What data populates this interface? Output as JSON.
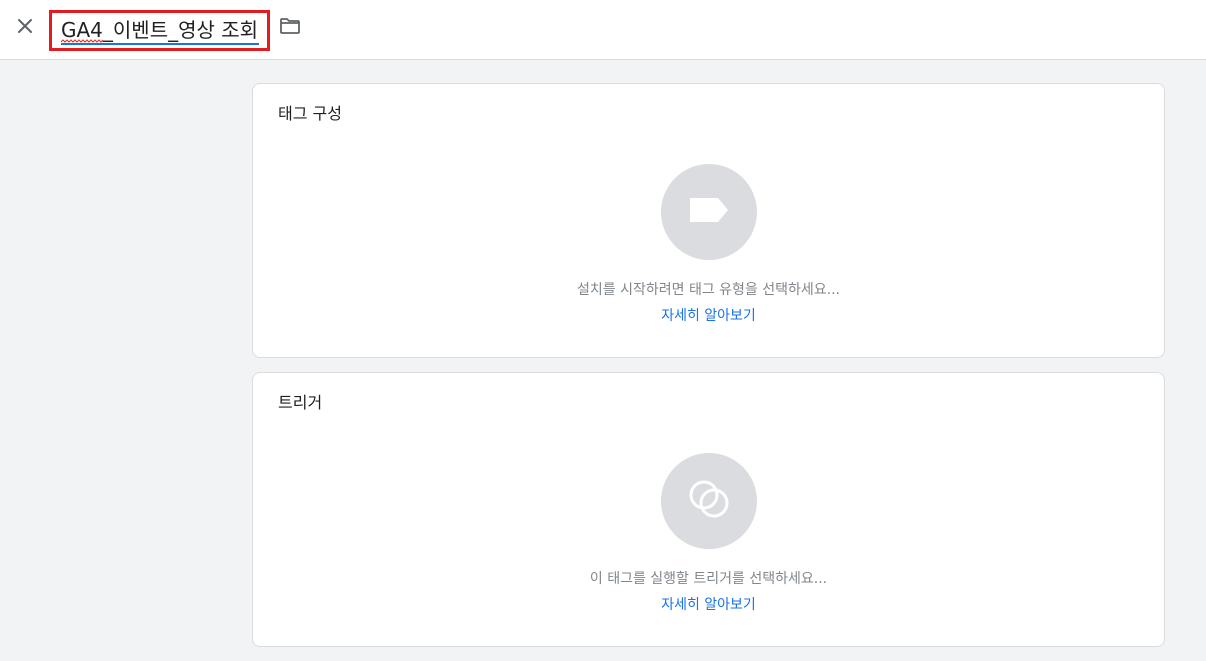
{
  "header": {
    "title": "GA4_이벤트_영상 조회",
    "close_icon": "close-icon",
    "folder_icon": "folder-icon"
  },
  "tag_config": {
    "title": "태그 구성",
    "icon": "tag-icon",
    "hint": "설치를 시작하려면 태그 유형을 선택하세요...",
    "learn_more": "자세히 알아보기"
  },
  "triggers": {
    "title": "트리거",
    "icon": "trigger-icon",
    "hint": "이 태그를 실행할 트리거를 선택하세요...",
    "learn_more": "자세히 알아보기"
  },
  "colors": {
    "accent": "#1a73e8",
    "highlight_border": "#e21d22",
    "icon_circle": "#dadce0"
  }
}
